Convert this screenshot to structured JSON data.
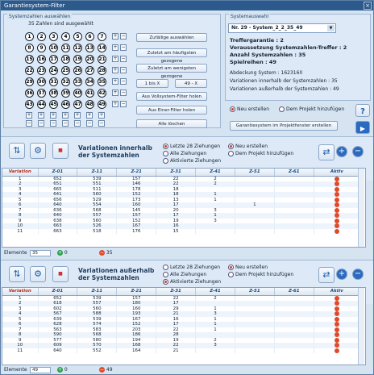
{
  "window": {
    "title": "Garantiesystem-Filter",
    "close": "×"
  },
  "left": {
    "group_title": "Systemzahlen auswählen",
    "count_label": "35 Zahlen sind ausgewählt",
    "buttons": [
      "Zufällige auswählen",
      "Zuletzt am häufigsten gezogene",
      "Zuletzt am wenigsten gezogene",
      "1 bis X",
      "49 - X",
      "Aus Vollsystem-Filter holen",
      "Aus Einer-Filter holen",
      "Alle löschen"
    ]
  },
  "right": {
    "group_title": "Systemauswahl",
    "system": "Nr. 29 - System_2_2_35_49",
    "lines": [
      "Treffergarantie : 2",
      "Voraussetzung Systemzahlen-Treffer : 2",
      "Anzahl Systemzahlen : 35",
      "Spielreihen : 49"
    ],
    "info": [
      "Abdeckung System : 1623160",
      "Variationen innerhalb der Systemzahlen : 35",
      "Variationen außerhalb der Systemzahlen : 49"
    ],
    "radio_new": "Neu erstellen",
    "radio_add": "Dem Projekt hinzufügen",
    "create_btn": "Garantiesystem im Projektfenster erstellen",
    "help": "?"
  },
  "sec1": {
    "title": "Variationen innerhalb\nder Systemzahlen",
    "r1": "Letzte 28 Ziehungen",
    "r2": "Alle Ziehungen",
    "r3": "Aktivierte Ziehungen",
    "r4": "Neu erstellen",
    "r5": "Dem Projekt hinzufügen",
    "headers": [
      "Variation",
      "Z-01",
      "Z-11",
      "Z-21",
      "Z-31",
      "Z-41",
      "Z-51",
      "Z-61",
      "Aktiv"
    ],
    "rows": [
      [
        "1",
        "652",
        "539",
        "157",
        "22",
        "2",
        ""
      ],
      [
        "2",
        "651",
        "551",
        "146",
        "22",
        "2",
        ""
      ],
      [
        "3",
        "665",
        "511",
        "178",
        "18",
        "",
        ""
      ],
      [
        "4",
        "641",
        "560",
        "152",
        "18",
        "1",
        ""
      ],
      [
        "5",
        "656",
        "529",
        "173",
        "13",
        "1",
        ""
      ],
      [
        "6",
        "640",
        "554",
        "160",
        "17",
        "",
        "1"
      ],
      [
        "7",
        "636",
        "568",
        "145",
        "20",
        "3",
        ""
      ],
      [
        "8",
        "640",
        "557",
        "157",
        "17",
        "1",
        ""
      ],
      [
        "9",
        "638",
        "560",
        "152",
        "19",
        "3",
        ""
      ],
      [
        "10",
        "663",
        "526",
        "167",
        "16",
        "",
        ""
      ],
      [
        "11",
        "663",
        "518",
        "176",
        "15",
        "",
        ""
      ]
    ],
    "footer_label": "Elemente",
    "footer_count": "35",
    "footer_green": "0",
    "footer_red": "35"
  },
  "sec2": {
    "title": "Variationen außerhalb\nder Systemzahlen",
    "r1": "Letzte 28 Ziehungen",
    "r2": "Alle Ziehungen",
    "r3": "Aktivierte Ziehungen",
    "r4": "Neu erstellen",
    "r5": "Dem Projekt hinzufügen",
    "rows": [
      [
        "1",
        "652",
        "539",
        "157",
        "22",
        "2",
        ""
      ],
      [
        "2",
        "618",
        "557",
        "180",
        "17",
        "",
        ""
      ],
      [
        "3",
        "602",
        "560",
        "160",
        "29",
        "1",
        ""
      ],
      [
        "4",
        "567",
        "588",
        "193",
        "21",
        "3",
        ""
      ],
      [
        "5",
        "639",
        "539",
        "167",
        "16",
        "1",
        ""
      ],
      [
        "6",
        "628",
        "574",
        "152",
        "17",
        "1",
        ""
      ],
      [
        "7",
        "563",
        "583",
        "203",
        "22",
        "1",
        ""
      ],
      [
        "8",
        "590",
        "568",
        "186",
        "28",
        "",
        ""
      ],
      [
        "9",
        "577",
        "580",
        "194",
        "19",
        "2",
        ""
      ],
      [
        "10",
        "609",
        "570",
        "168",
        "22",
        "3",
        ""
      ],
      [
        "11",
        "640",
        "552",
        "164",
        "21",
        "",
        ""
      ]
    ],
    "footer_label": "Elemente",
    "footer_count": "49",
    "footer_green": "0",
    "footer_red": "49"
  },
  "numbers": [
    "1",
    "2",
    "3",
    "4",
    "5",
    "6",
    "7",
    "8",
    "9",
    "10",
    "11",
    "12",
    "13",
    "14",
    "15",
    "16",
    "17",
    "18",
    "19",
    "20",
    "21",
    "22",
    "23",
    "24",
    "25",
    "26",
    "27",
    "28",
    "29",
    "30",
    "31",
    "32",
    "33",
    "34",
    "35",
    "36",
    "37",
    "38",
    "39",
    "40",
    "41",
    "42",
    "43",
    "44",
    "45",
    "46",
    "47",
    "48",
    "49"
  ]
}
